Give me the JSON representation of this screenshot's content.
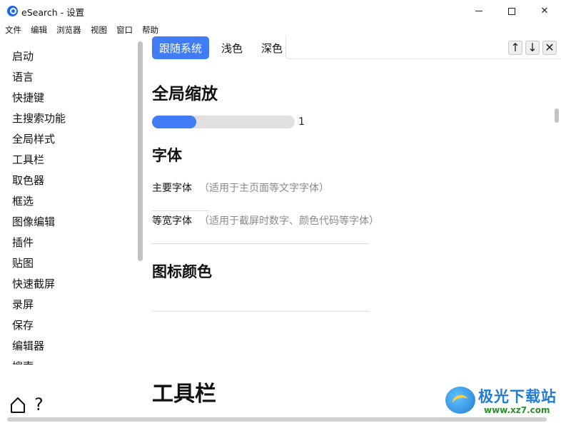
{
  "window": {
    "title": "eSearch - 设置",
    "min_symbol": "",
    "max_symbol": "",
    "close_symbol": "✕"
  },
  "menubar": [
    "文件",
    "编辑",
    "浏览器",
    "视图",
    "窗口",
    "帮助"
  ],
  "sidebar": {
    "items": [
      "启动",
      "语言",
      "快捷键",
      "主搜索功能",
      "全局样式",
      "工具栏",
      "取色器",
      "框选",
      "图像编辑",
      "插件",
      "贴图",
      "快速截屏",
      "录屏",
      "保存",
      "编辑器",
      "搜索"
    ],
    "help_symbol": "?"
  },
  "theme_tabs": [
    "跟随系统",
    "浅色",
    "深色"
  ],
  "find_bar": {
    "up": "↑",
    "down": "↓",
    "close": "✕"
  },
  "global_zoom": {
    "heading": "全局缩放",
    "value": "1",
    "fill_fraction": 0.31
  },
  "fonts": {
    "heading": "字体",
    "main_label": "主要字体",
    "main_hint": "（适用于主页面等文字字体）",
    "mono_label": "等宽字体",
    "mono_hint": "（适用于截屏时数字、颜色代码等字体）"
  },
  "icon_color": {
    "heading": "图标颜色"
  },
  "toolbar_section": {
    "heading": "工具栏"
  },
  "watermark": {
    "brand": "极光下载站",
    "url": "www.xz7.com"
  },
  "colors": {
    "accent": "#3f7cf5",
    "track": "#e0e0e0",
    "hint": "#8a8a8a"
  }
}
